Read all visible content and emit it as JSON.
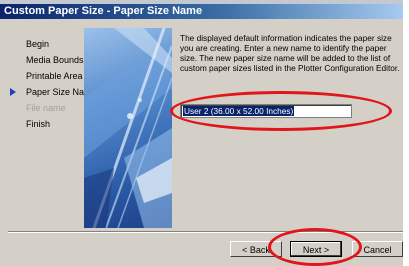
{
  "window": {
    "title": "Custom Paper Size - Paper Size Name"
  },
  "nav": {
    "items": [
      {
        "label": "Begin",
        "state": "normal"
      },
      {
        "label": "Media Bounds",
        "state": "normal"
      },
      {
        "label": "Printable Area",
        "state": "normal"
      },
      {
        "label": "Paper Size Name",
        "state": "current"
      },
      {
        "label": "File name",
        "state": "disabled"
      },
      {
        "label": "Finish",
        "state": "normal"
      }
    ]
  },
  "main": {
    "description": "The displayed default information indicates the paper size you are creating. Enter a new name to identify the paper size. The new paper size name will be added to the list of custom paper sizes listed in the Plotter Configuration Editor.",
    "name_field": {
      "value": "User 2 (36.00 x 52.00 Inches)"
    }
  },
  "buttons": {
    "back": "< Back",
    "next": "Next >",
    "cancel": "Cancel"
  },
  "annotations": {
    "color": "#e0161b"
  },
  "icons": {
    "current_step_indicator": "arrow-right-icon",
    "wizard_image": "plotter-illustration"
  }
}
